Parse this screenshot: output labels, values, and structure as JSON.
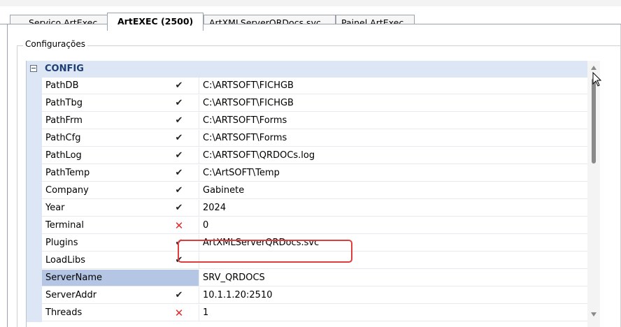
{
  "tabs": [
    {
      "label": "Serviço ArtExec"
    },
    {
      "label": "ArtEXEC (2500)",
      "active": true
    },
    {
      "label": "ArtXMLServerQRDocs.svc"
    },
    {
      "label": "Painel ArtExec"
    }
  ],
  "group": {
    "label": "Configurações"
  },
  "grid": {
    "category": "CONFIG",
    "rows": [
      {
        "name": "PathDB",
        "value": "C:\\ARTSOFT\\FICHGB",
        "mark": "✔"
      },
      {
        "name": "PathTbg",
        "value": "C:\\ARTSOFT\\FICHGB",
        "mark": "✔"
      },
      {
        "name": "PathFrm",
        "value": "C:\\ARTSOFT\\Forms",
        "mark": "✔"
      },
      {
        "name": "PathCfg",
        "value": "C:\\ARTSOFT\\Forms",
        "mark": "✔"
      },
      {
        "name": "PathLog",
        "value": "C:\\ARTSOFT\\QRDOCs.log",
        "mark": "✔"
      },
      {
        "name": "PathTemp",
        "value": "C:\\ArtSOFT\\Temp",
        "mark": "✔"
      },
      {
        "name": "Company",
        "value": "Gabinete",
        "mark": "✔"
      },
      {
        "name": "Year",
        "value": "2024",
        "mark": "✔"
      },
      {
        "name": "Terminal",
        "value": "0",
        "mark": "✕"
      },
      {
        "name": "Plugins",
        "value": "ArtXMLServerQRDocs.svc",
        "mark": "✔"
      },
      {
        "name": "LoadLibs",
        "value": "",
        "mark": "✔"
      },
      {
        "name": "ServerName",
        "value": "SRV_QRDOCS",
        "mark": ""
      },
      {
        "name": "ServerAddr",
        "value": "10.1.1.20:2510",
        "mark": "✔"
      },
      {
        "name": "Threads",
        "value": "1",
        "mark": "✕"
      }
    ],
    "selected_row": "ServerName",
    "highlighted_row": "Plugins"
  },
  "colors": {
    "category_bg": "#dce6f4",
    "selected_bg": "#b4c6e4",
    "check": "#222222",
    "cross": "#e02a2a",
    "highlight": "#e03c3c"
  },
  "icons": {
    "expander": "minus-box-icon",
    "scroll_up": "triangle-up-icon",
    "scroll_down": "triangle-down-icon",
    "cursor": "mouse-pointer-icon"
  }
}
